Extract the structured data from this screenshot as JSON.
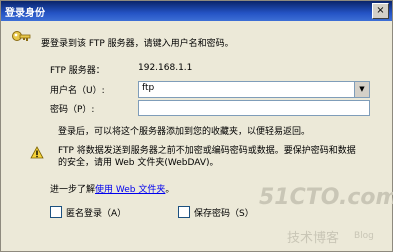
{
  "window": {
    "title": "登录身份",
    "close_label": "×"
  },
  "intro": "要登录到该 FTP 服务器，请键入用户名和密码。",
  "server": {
    "label": "FTP 服务器：",
    "value": "192.168.1.1"
  },
  "username": {
    "label": "用户名（U）:",
    "value": "ftp"
  },
  "password": {
    "label": "密码（P）:",
    "value": ""
  },
  "note": "登录后，可以将这个服务器添加到您的收藏夹，以便轻易返回。",
  "warning": {
    "line1": "FTP 将数据发送到服务器之前不加密或编码密码或数据。要保护密码和数据",
    "line2": "的安全，请用 Web 文件夹(WebDAV)。"
  },
  "learn_more": {
    "prefix": "进一步了解",
    "link": "使用 Web 文件夹",
    "suffix": "。"
  },
  "options": {
    "anonymous": "匿名登录（A）",
    "save_password": "保存密码（S）"
  },
  "watermark": {
    "brand": "51CTO.com",
    "sub": "技术博客",
    "blog": "Blog"
  }
}
